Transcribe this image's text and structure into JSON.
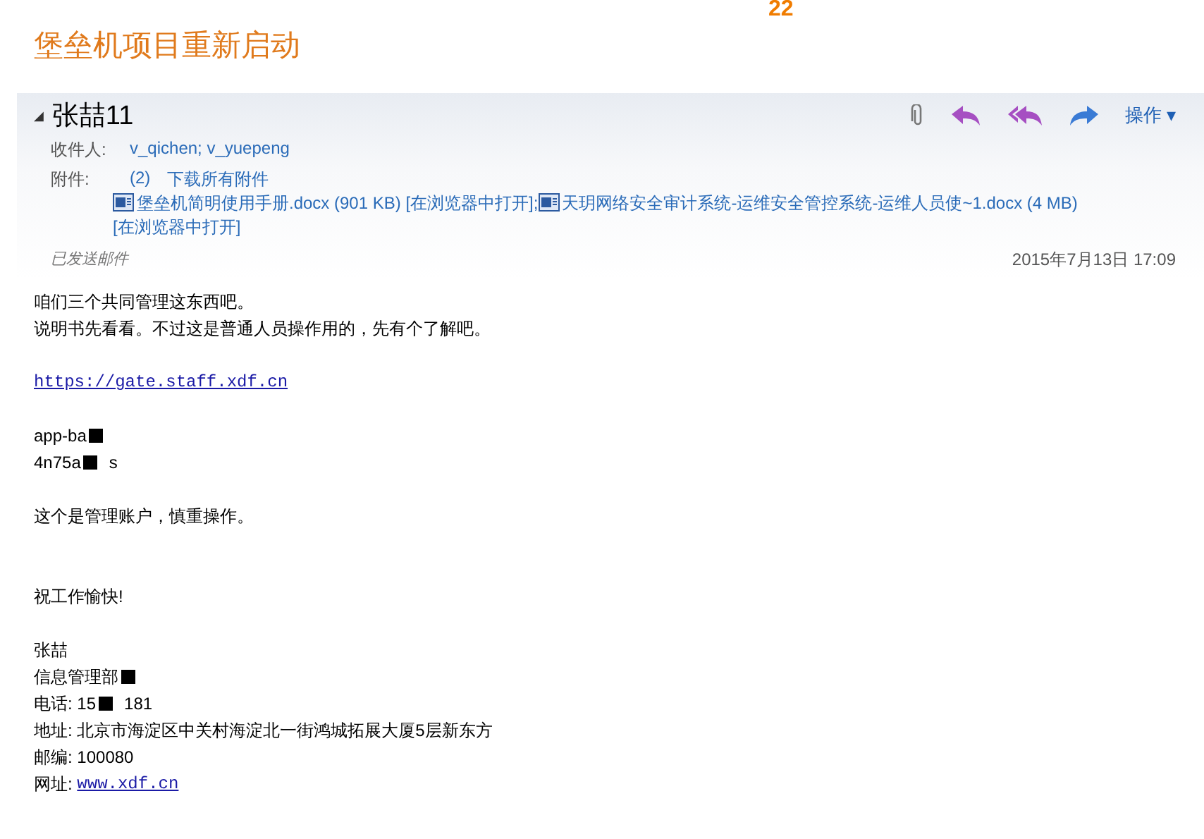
{
  "top_bar": {
    "badge": "22"
  },
  "subject": "堡垒机项目重新启动",
  "header": {
    "collapse_glyph": "◢",
    "sender": "张喆11",
    "actions_label": "操作",
    "actions_caret": "▾",
    "separator": ";",
    "to_label": "收件人:",
    "to": "v_qichen; v_yuepeng",
    "attach_label": "附件:",
    "attach_count": "(2)",
    "download_all": "下载所有附件",
    "attachments": [
      {
        "name": "堡垒机简明使用手册.docx (901 KB)",
        "open": "[在浏览器中打开]"
      },
      {
        "name": "天玥网络安全审计系统-运维安全管控系统-运维人员使~1.docx (4 MB)",
        "open": "[在浏览器中打开]"
      }
    ],
    "folder": "已发送邮件",
    "date": "2015年7月13日 17:09"
  },
  "body": [
    {
      "kind": "text",
      "text": "咱们三个共同管理这东西吧。"
    },
    {
      "kind": "text",
      "text": "说明书先看看。不过这是普通人员操作用的，先有个了解吧。"
    },
    {
      "kind": "blank"
    },
    {
      "kind": "link",
      "text": "https://gate.staff.xdf.cn"
    },
    {
      "kind": "blank"
    },
    {
      "kind": "mixed",
      "parts": [
        {
          "kind": "text",
          "text": "app-ba"
        },
        {
          "kind": "redaction"
        }
      ]
    },
    {
      "kind": "mixed",
      "parts": [
        {
          "kind": "text",
          "text": "4n75a"
        },
        {
          "kind": "redaction"
        },
        {
          "kind": "text",
          "text": "s"
        }
      ]
    },
    {
      "kind": "blank"
    },
    {
      "kind": "text",
      "text": "这个是管理账户，慎重操作。"
    },
    {
      "kind": "blank"
    },
    {
      "kind": "blank"
    },
    {
      "kind": "text",
      "text": "祝工作愉快!"
    },
    {
      "kind": "blank"
    },
    {
      "kind": "text",
      "text": "张喆"
    },
    {
      "kind": "mixed",
      "parts": [
        {
          "kind": "text",
          "text": "信息管理部"
        },
        {
          "kind": "redaction"
        }
      ]
    },
    {
      "kind": "mixed",
      "parts": [
        {
          "kind": "text",
          "text": "电话: 15"
        },
        {
          "kind": "redaction"
        },
        {
          "kind": "text",
          "text": "181"
        }
      ]
    },
    {
      "kind": "text",
      "text": "地址: 北京市海淀区中关村海淀北一街鸿城拓展大厦5层新东方"
    },
    {
      "kind": "text",
      "text": "邮编: 100080"
    },
    {
      "kind": "mixed",
      "parts": [
        {
          "kind": "text",
          "text": "网址: "
        },
        {
          "kind": "link",
          "text": "www.xdf.cn"
        }
      ]
    }
  ]
}
